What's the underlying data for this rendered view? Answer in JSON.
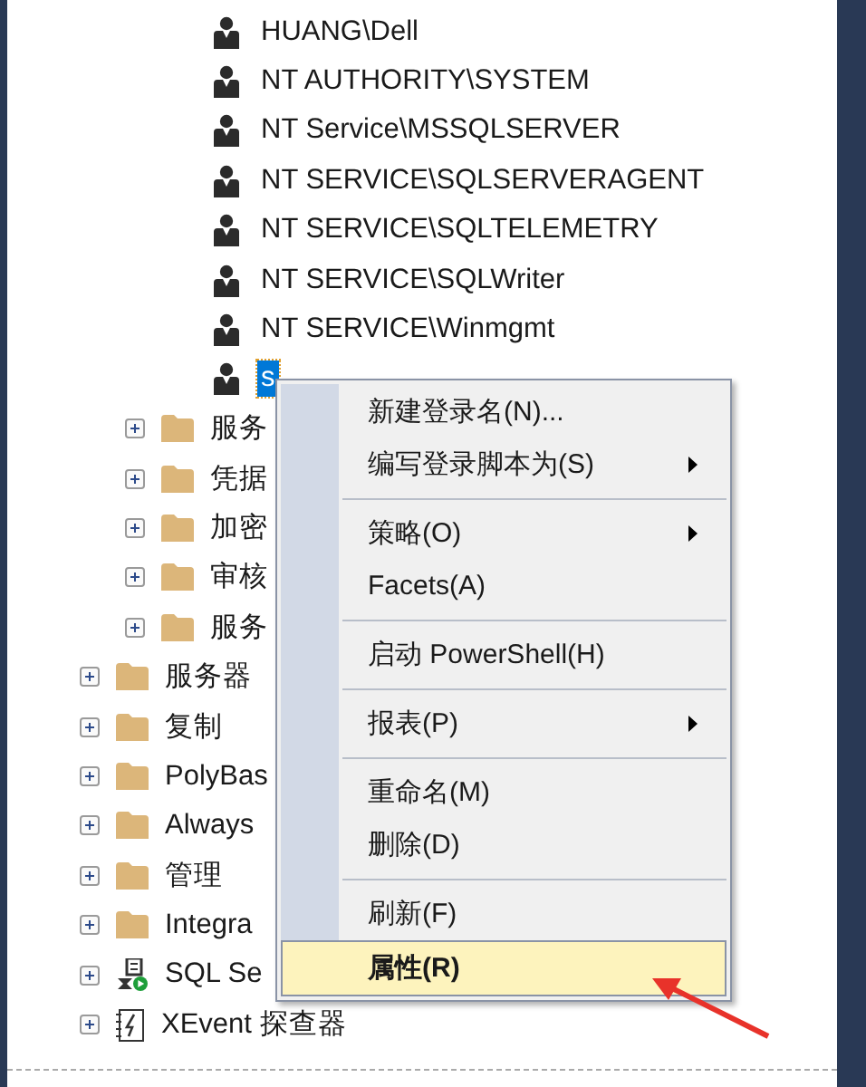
{
  "logins": [
    {
      "name": "HUANG\\Dell",
      "selected": false
    },
    {
      "name": "NT AUTHORITY\\SYSTEM",
      "selected": false
    },
    {
      "name": "NT Service\\MSSQLSERVER",
      "selected": false
    },
    {
      "name": "NT SERVICE\\SQLSERVERAGENT",
      "selected": false
    },
    {
      "name": "NT SERVICE\\SQLTELEMETRY",
      "selected": false
    },
    {
      "name": "NT SERVICE\\SQLWriter",
      "selected": false
    },
    {
      "name": "NT SERVICE\\Winmgmt",
      "selected": false
    },
    {
      "name": "s",
      "selected": true
    }
  ],
  "security_folders": [
    {
      "name": "服务",
      "expanded": false
    },
    {
      "name": "凭据",
      "expanded": false
    },
    {
      "name": "加密",
      "expanded": false
    },
    {
      "name": "审核",
      "expanded": false
    },
    {
      "name": "服务",
      "expanded": false
    }
  ],
  "server_nodes": [
    {
      "name": "服务器",
      "kind": "folder",
      "expanded": false
    },
    {
      "name": "复制",
      "kind": "folder",
      "expanded": false
    },
    {
      "name": "PolyBas",
      "kind": "folder",
      "expanded": false
    },
    {
      "name": "Always",
      "kind": "folder",
      "expanded": false
    },
    {
      "name": "管理",
      "kind": "folder",
      "expanded": false
    },
    {
      "name": "Integra",
      "kind": "folder",
      "expanded": false
    },
    {
      "name": "SQL Se",
      "kind": "agent",
      "expanded": false
    },
    {
      "name": "XEvent 探查器",
      "kind": "xevent",
      "expanded": false
    }
  ],
  "context_menu": {
    "sections": [
      [
        {
          "label": "新建登录名(N)...",
          "submenu": false,
          "selected": false
        },
        {
          "label": "编写登录脚本为(S)",
          "submenu": true,
          "selected": false
        }
      ],
      [
        {
          "label": "策略(O)",
          "submenu": true,
          "selected": false
        },
        {
          "label": "Facets(A)",
          "submenu": false,
          "selected": false
        }
      ],
      [
        {
          "label": "启动 PowerShell(H)",
          "submenu": false,
          "selected": false
        }
      ],
      [
        {
          "label": "报表(P)",
          "submenu": true,
          "selected": false
        }
      ],
      [
        {
          "label": "重命名(M)",
          "submenu": false,
          "selected": false
        },
        {
          "label": "删除(D)",
          "submenu": false,
          "selected": false
        }
      ],
      [
        {
          "label": "刷新(F)",
          "submenu": false,
          "selected": false
        },
        {
          "label": "属性(R)",
          "submenu": false,
          "selected": true
        }
      ]
    ]
  }
}
